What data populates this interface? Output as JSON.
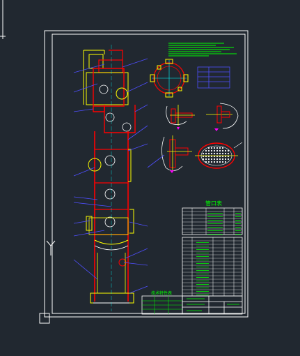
{
  "colors": {
    "background": "#212830",
    "frame": "#ffffff",
    "vessel": "#ff0000",
    "fittings": "#ffff00",
    "leaders": "#4f4fff",
    "notes": "#00ff00",
    "cyan": "#00ffff",
    "magenta": "#ff00ff"
  },
  "drawing": {
    "nozzle_table_title": "管口表",
    "spec_table_title": "技术特性表"
  }
}
